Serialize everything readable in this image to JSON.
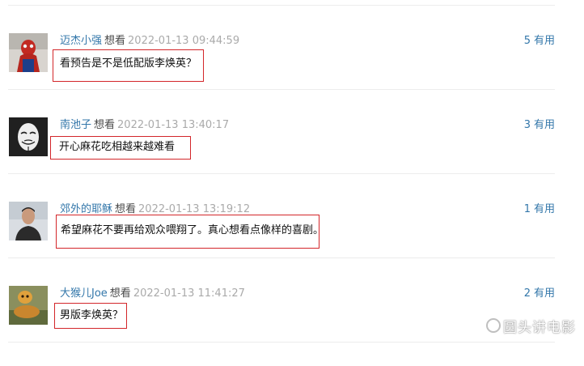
{
  "comments": [
    {
      "user": "迈杰小强",
      "status": "想看",
      "time": "2022-01-13 09:44:59",
      "useful_count": "5",
      "useful_label": "有用",
      "content": "看预告是不是低配版李焕英？"
    },
    {
      "user": "南池子",
      "status": "想看",
      "time": "2022-01-13 13:40:17",
      "useful_count": "3",
      "useful_label": "有用",
      "content": "开心麻花吃相越来越难看"
    },
    {
      "user": "郊外的耶稣",
      "status": "想看",
      "time": "2022-01-13 13:19:12",
      "useful_count": "1",
      "useful_label": "有用",
      "content": "希望麻花不要再给观众喂翔了。真心想看点像样的喜剧。"
    },
    {
      "user": "大猴儿Joe",
      "status": "想看",
      "time": "2022-01-13 11:41:27",
      "useful_count": "2",
      "useful_label": "有用",
      "content": "男版李焕英？"
    }
  ],
  "watermark": "圆头讲电影",
  "colors": {
    "link": "#3377aa",
    "time": "#aaaaaa",
    "highlight_border": "#d3262a"
  }
}
